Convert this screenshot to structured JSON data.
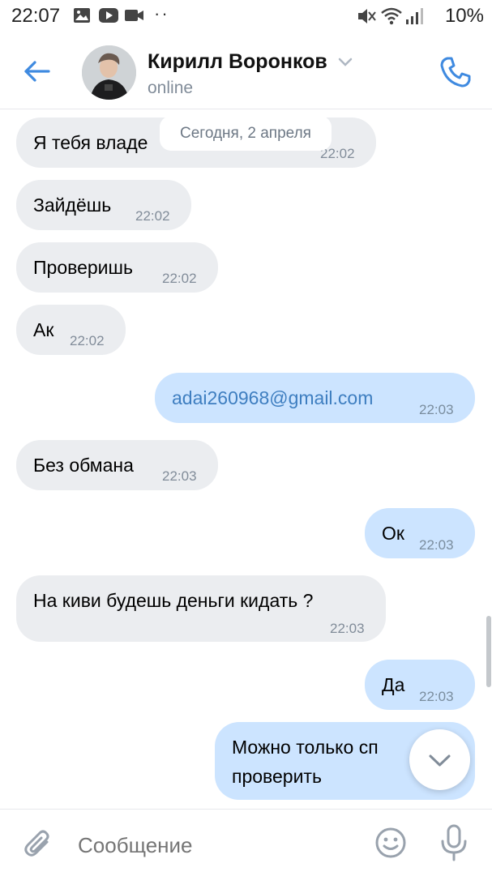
{
  "status_bar": {
    "time": "22:07",
    "dots": "··",
    "battery": "10%",
    "icons": [
      "image-icon",
      "youtube-icon",
      "video-icon",
      "mute-icon",
      "wifi-icon",
      "signal-icon"
    ]
  },
  "header": {
    "contact_name": "Кирилл Воронков",
    "presence": "online",
    "icons": [
      "back-arrow-icon",
      "chevron-down-icon",
      "phone-icon"
    ],
    "accent_color": "#3f8ae0"
  },
  "date_chip": "Сегодня, 2 апреля",
  "messages": [
    {
      "direction": "in",
      "text": "Я тебя владе",
      "time": "22:02"
    },
    {
      "direction": "in",
      "text": "Зайдёшь",
      "time": "22:02"
    },
    {
      "direction": "in",
      "text": "Проверишь",
      "time": "22:02"
    },
    {
      "direction": "in",
      "text": "Ак",
      "time": "22:02"
    },
    {
      "direction": "out",
      "text": "adai260968@gmail.com",
      "time": "22:03"
    },
    {
      "direction": "in",
      "text": "Без обмана",
      "time": "22:03"
    },
    {
      "direction": "out",
      "text": "Ок",
      "time": "22:03"
    },
    {
      "direction": "in",
      "text": "На киви будешь деньги кидать ?",
      "time": "22:03"
    },
    {
      "direction": "out",
      "text": "Да",
      "time": "22:03"
    },
    {
      "direction": "out",
      "text_line1": "Можно только сп",
      "text_line2": "проверить"
    }
  ],
  "composer": {
    "placeholder": "Сообщение",
    "icons": [
      "paperclip-icon",
      "emoji-icon",
      "microphone-icon"
    ]
  },
  "colors": {
    "incoming_bubble": "#ebedf0",
    "outgoing_bubble": "#cce4ff",
    "link": "#3e7ec0",
    "secondary_text": "#818c99"
  }
}
